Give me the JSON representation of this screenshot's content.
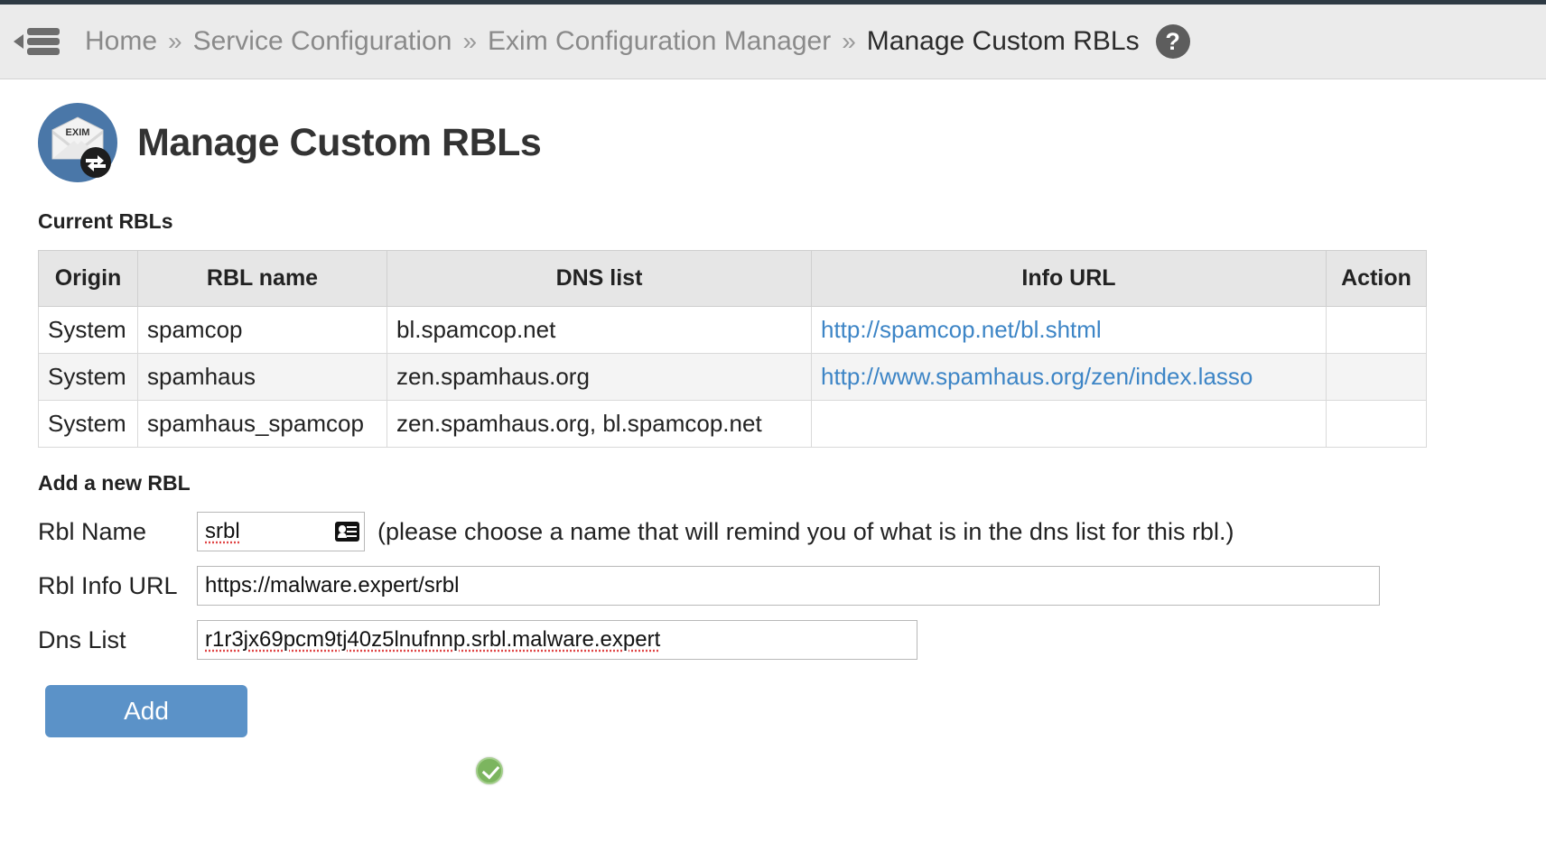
{
  "topbar": {
    "collapse_icon": "collapse-sidebar-icon",
    "breadcrumb": {
      "items": [
        {
          "label": "Home",
          "current": false
        },
        {
          "label": "Service Configuration",
          "current": false
        },
        {
          "label": "Exim Configuration Manager",
          "current": false
        },
        {
          "label": "Manage Custom RBLs",
          "current": true
        }
      ],
      "separator": "»"
    },
    "help_icon": "help-circle-icon",
    "help_glyph": "?"
  },
  "header": {
    "logo_icon": "exim-mail-exchange-logo",
    "logo_text": "EXIM",
    "title": "Manage Custom RBLs"
  },
  "current_rbls": {
    "section_label": "Current RBLs",
    "columns": [
      "Origin",
      "RBL name",
      "DNS list",
      "Info URL",
      "Action"
    ],
    "rows": [
      {
        "origin": "System",
        "name": "spamcop",
        "dns": "bl.spamcop.net",
        "url": "http://spamcop.net/bl.shtml",
        "action": ""
      },
      {
        "origin": "System",
        "name": "spamhaus",
        "dns": "zen.spamhaus.org",
        "url": "http://www.spamhaus.org/zen/index.lasso",
        "action": ""
      },
      {
        "origin": "System",
        "name": "spamhaus_spamcop",
        "dns": "zen.spamhaus.org, bl.spamcop.net",
        "url": "",
        "action": ""
      }
    ]
  },
  "add_form": {
    "section_label": "Add a new RBL",
    "fields": {
      "name": {
        "label": "Rbl Name",
        "value": "srbl",
        "placeholder": "",
        "hint": "(please choose a name that will remind you of what is in the dns list for this rbl.)",
        "autofill_icon": "contact-card-autofill-icon"
      },
      "info_url": {
        "label": "Rbl Info URL",
        "value": "https://malware.expert/srbl",
        "placeholder": ""
      },
      "dns_list": {
        "label": "Dns List",
        "value": "r1r3jx69pcm9tj40z5lnufnnp.srbl.malware.expert",
        "placeholder": ""
      }
    },
    "submit_label": "Add",
    "status_icon": "success-check-icon"
  },
  "colors": {
    "accent_button": "#5b92c8",
    "link": "#3d85c6",
    "breadcrumb_bg": "#ebebeb",
    "table_header_bg": "#e6e6e6",
    "success_green": "#7cb55f",
    "logo_blue": "#4a77a8"
  }
}
